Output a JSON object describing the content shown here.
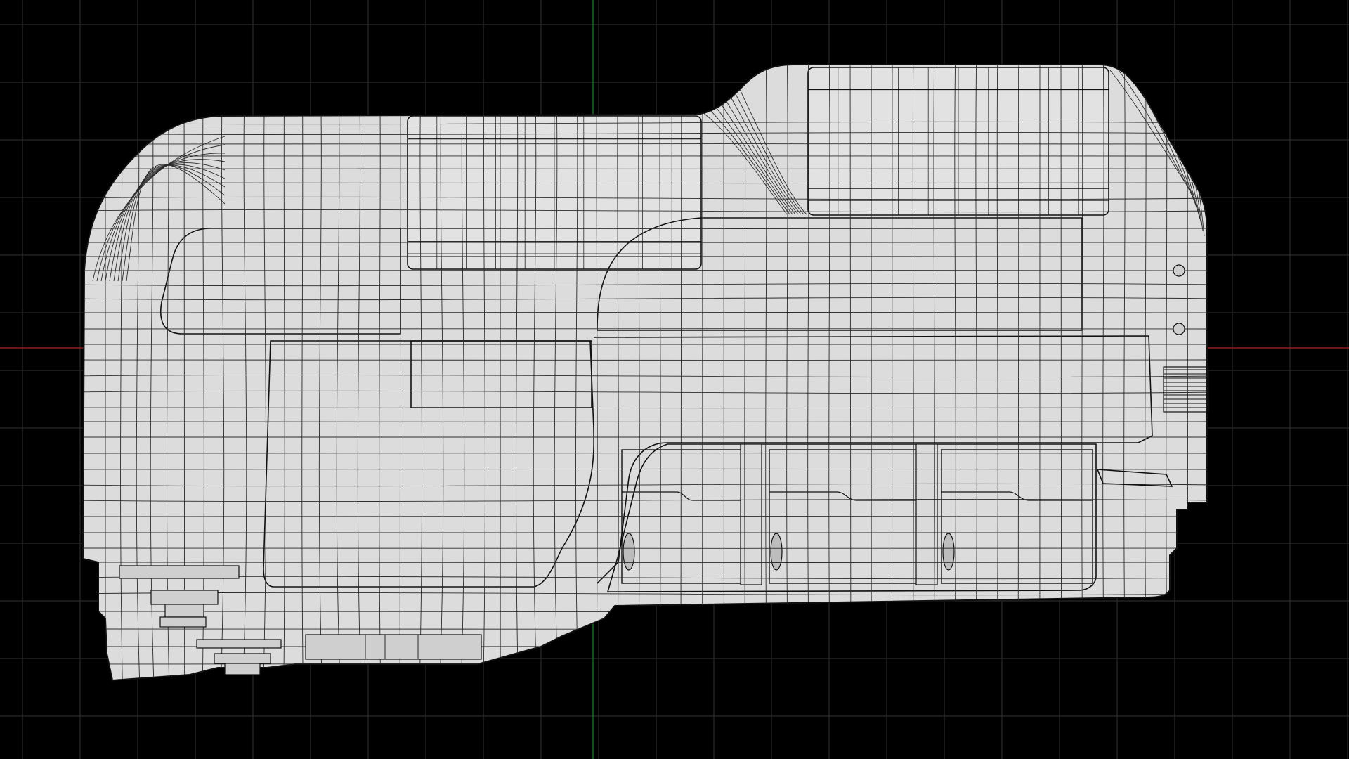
{
  "viewport": {
    "view": "orthographic-side",
    "render_mode": "wireframe-on-shaded",
    "background_color": "#000000",
    "grid_color": "#2a2a2a",
    "x_axis_color": "#8a2020",
    "y_axis_color": "#1f6b2a",
    "model_color": "#dcdcdc",
    "wire_color": "#2b2b2b"
  },
  "model": {
    "icon": "mesh-object-icon"
  }
}
